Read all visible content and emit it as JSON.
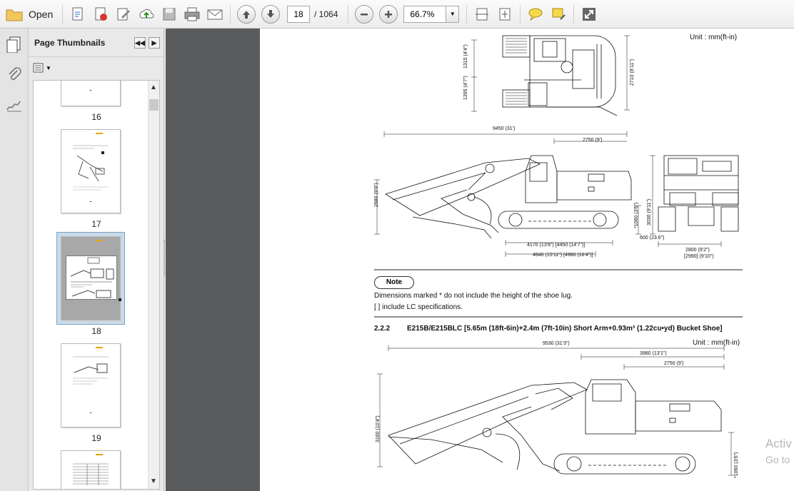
{
  "toolbar": {
    "open_label": "Open",
    "page_current": "18",
    "page_total": "/ 1064",
    "zoom": "66.7%"
  },
  "panel": {
    "title": "Page Thumbnails",
    "thumbs": [
      "16",
      "17",
      "18",
      "19"
    ]
  },
  "document": {
    "unit_top": "Unit : mm(ft-in)",
    "note_label": "Note",
    "note_line1": "Dimensions marked * do not include the height of the shoe lug.",
    "note_line2": "[ ] include LC specifications.",
    "section_num": "2.2.2",
    "section_title": "E215B/E215BLC [5.65m (18ft-6in)+2.4m (7ft-10in) Short Arm+0.93m³ (1.22cu•yd) Bucket Shoe]",
    "unit_bottom": "Unit : mm(ft-in)",
    "dims": {
      "a": "9450 (31')",
      "b": "2750 (9')",
      "c": "2980 (9'9\")",
      "d": "4170 (13'8\") [4450 (14'7\")]",
      "e": "4840 (15'11\") [4980 (16'4\")]",
      "f": "600 (23.6\")",
      "g": "2800 (9'2\")",
      "h": "[2990] (9'10\")",
      "i": "9530 (31'3\")",
      "j": "3980 (13'1\")",
      "k": "2750 (9')",
      "l": "3160 (10'4\")",
      "m": "*1060 (3'6\")",
      "n": "1315 (4'4\")",
      "o": "1395 (4'7\")",
      "p": "2710 (8'11\")",
      "q": "3030 (9'11\")",
      "r": "*1060 (3'6\")"
    }
  },
  "watermark": {
    "line1": "Activ",
    "line2": "Go to"
  }
}
